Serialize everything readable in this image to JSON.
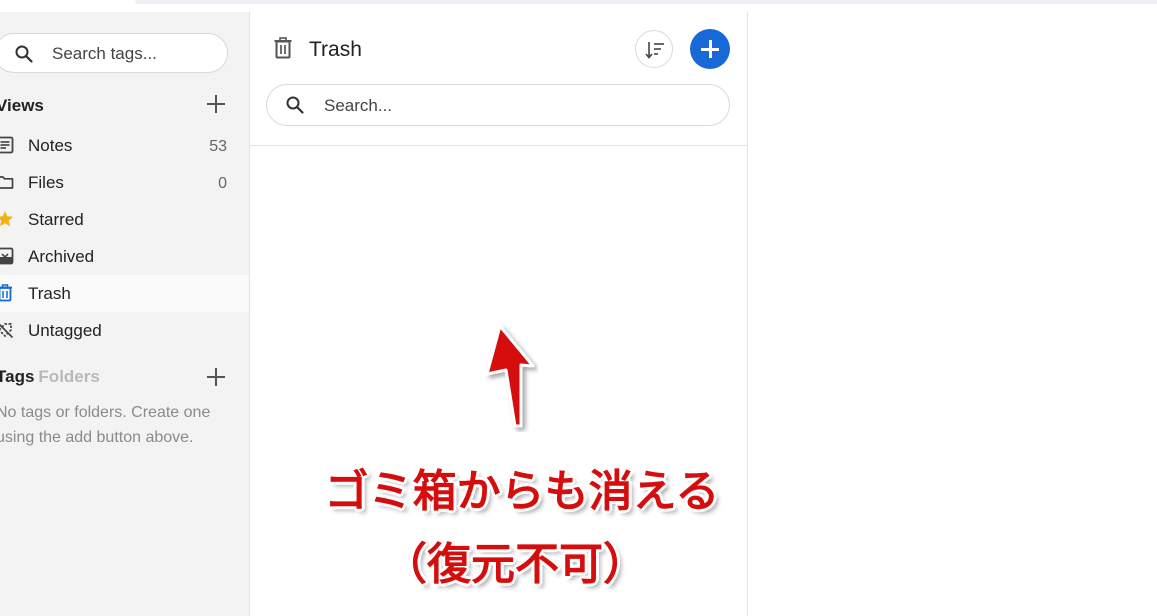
{
  "sidebar": {
    "tag_search_placeholder": "Search tags...",
    "views_heading": "Views",
    "items": [
      {
        "label": "Notes",
        "count": "53",
        "icon": "notes-icon"
      },
      {
        "label": "Files",
        "count": "0",
        "icon": "folder-icon"
      },
      {
        "label": "Starred",
        "count": "",
        "icon": "star-icon"
      },
      {
        "label": "Archived",
        "count": "",
        "icon": "archive-icon"
      },
      {
        "label": "Trash",
        "count": "",
        "icon": "trash-icon"
      },
      {
        "label": "Untagged",
        "count": "",
        "icon": "untagged-icon"
      }
    ],
    "tags_heading": "Tags",
    "folders_heading": "Folders",
    "empty_message": "No tags or folders. Create one using the add button above."
  },
  "notes_list": {
    "title": "Trash",
    "search_placeholder": "Search..."
  },
  "annotation": {
    "line1": "ゴミ箱からも消える",
    "line2": "（復元不可）"
  },
  "colors": {
    "accent": "#1868d8",
    "star": "#f2b30c",
    "annotation": "#d60d0d"
  }
}
